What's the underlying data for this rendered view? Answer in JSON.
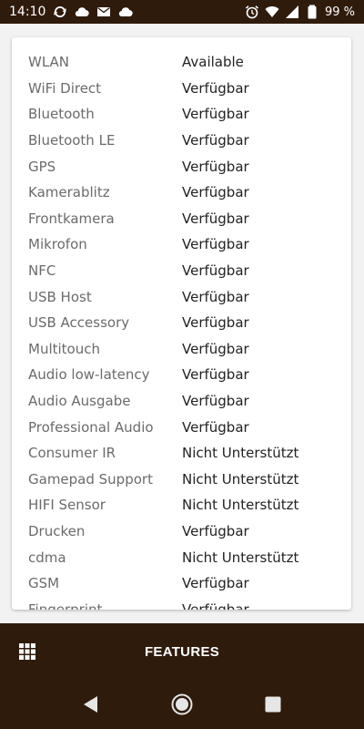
{
  "status_bar": {
    "time": "14:10",
    "battery": "99 %",
    "left_icons": [
      "sync-icon",
      "cloud-icon",
      "mail-icon",
      "cloud-icon"
    ],
    "right_icons": [
      "alarm-icon",
      "wifi-icon",
      "signal-icon",
      "battery-icon"
    ]
  },
  "features": [
    {
      "name": "WLAN",
      "status": "Available"
    },
    {
      "name": "WiFi Direct",
      "status": "Verfügbar"
    },
    {
      "name": "Bluetooth",
      "status": "Verfügbar"
    },
    {
      "name": "Bluetooth LE",
      "status": "Verfügbar"
    },
    {
      "name": "GPS",
      "status": "Verfügbar"
    },
    {
      "name": "Kamerablitz",
      "status": "Verfügbar"
    },
    {
      "name": "Frontkamera",
      "status": "Verfügbar"
    },
    {
      "name": "Mikrofon",
      "status": "Verfügbar"
    },
    {
      "name": "NFC",
      "status": "Verfügbar"
    },
    {
      "name": "USB Host",
      "status": "Verfügbar"
    },
    {
      "name": "USB Accessory",
      "status": "Verfügbar"
    },
    {
      "name": "Multitouch",
      "status": "Verfügbar"
    },
    {
      "name": "Audio low-latency",
      "status": "Verfügbar"
    },
    {
      "name": "Audio Ausgabe",
      "status": "Verfügbar"
    },
    {
      "name": "Professional Audio",
      "status": "Verfügbar"
    },
    {
      "name": "Consumer IR",
      "status": "Nicht Unterstützt"
    },
    {
      "name": "Gamepad Support",
      "status": "Nicht Unterstützt"
    },
    {
      "name": "HIFI Sensor",
      "status": "Nicht Unterstützt"
    },
    {
      "name": "Drucken",
      "status": "Verfügbar"
    },
    {
      "name": "cdma",
      "status": "Nicht Unterstützt"
    },
    {
      "name": "GSM",
      "status": "Verfügbar"
    },
    {
      "name": "Fingerprint",
      "status": "Verfügbar"
    }
  ],
  "bottom_bar": {
    "title": "FEATURES",
    "menu_icon": "grid-icon"
  },
  "nav_bar": {
    "icons": [
      "back-icon",
      "home-icon",
      "recents-icon"
    ]
  },
  "colors": {
    "bar_background": "#2f1b0c",
    "page_background": "#f2f2f2",
    "card_background": "#ffffff",
    "feature_name": "#6b6b6b",
    "feature_status": "#222222"
  }
}
